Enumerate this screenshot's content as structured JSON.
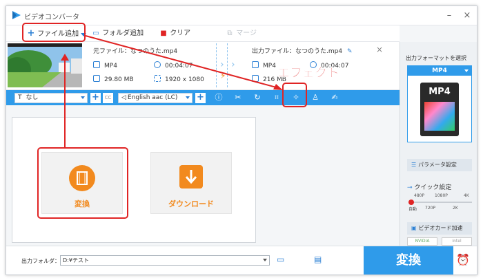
{
  "app": {
    "title": "ビデオコンバータ"
  },
  "toolbar": {
    "add_file": "ファイル追加",
    "add_folder": "フォルダ追加",
    "clear": "クリア",
    "merge": "マージ"
  },
  "file": {
    "source_label": "元ファイル：",
    "source_name": "なつのうた.mp4",
    "output_label": "出力ファイル：",
    "output_name": "なつのうた.mp4",
    "src_format": "MP4",
    "src_duration": "00:04:07",
    "src_size": "29.80 MB",
    "src_resolution": "1920 x 1080",
    "out_format": "MP4",
    "out_duration": "00:04:07",
    "out_size": "216 MB"
  },
  "editbar": {
    "subtitle": "なし",
    "audio": "English aac (LC)"
  },
  "annotation": {
    "effect": "エフェクト"
  },
  "actions": {
    "convert": "変換",
    "download": "ダウンロード"
  },
  "panel": {
    "title": "出力フォーマットを選択",
    "format": "MP4",
    "format_icon": "MP4",
    "params": "パラメータ設定",
    "quick": "クイック設定",
    "res_top": [
      "480P",
      "1080P",
      "4K"
    ],
    "res_bottom": [
      "自動",
      "720P",
      "2K"
    ],
    "gpu": "ビデオカード加速",
    "nvidia": "NVIDIA",
    "intel": "Intel"
  },
  "bottom": {
    "folder_label": "出力フォルダ：",
    "folder_path": "D:¥テスト",
    "convert": "変換"
  },
  "colors": {
    "accent": "#2f9bea",
    "orange": "#f28a1e",
    "annotation": "#e02424"
  }
}
